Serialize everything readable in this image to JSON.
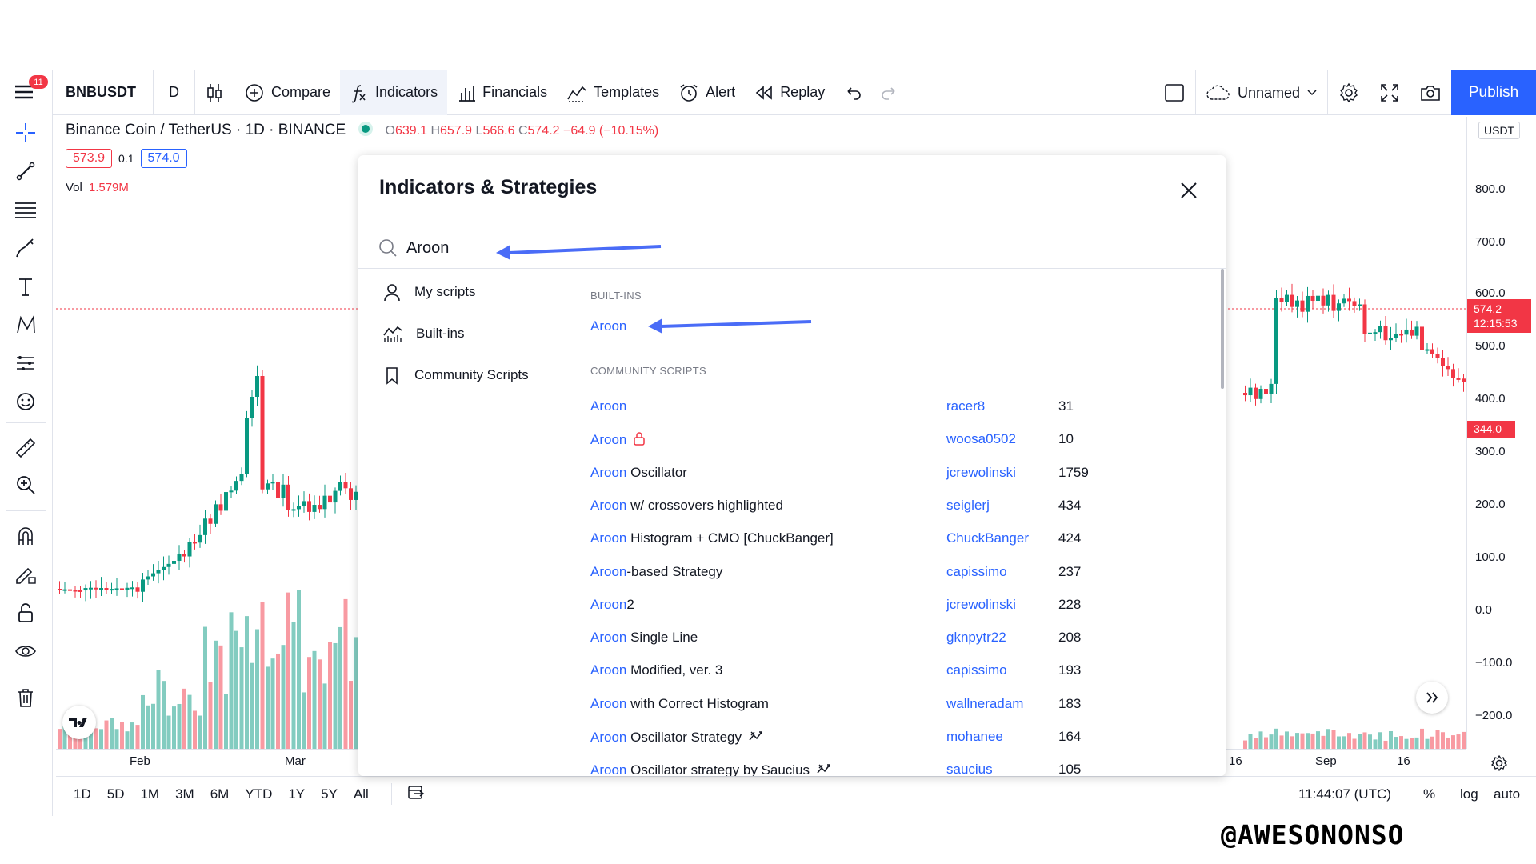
{
  "toolbar": {
    "menu_badge": "11",
    "symbol": "BNBUSDT",
    "interval": "D",
    "compare": "Compare",
    "indicators": "Indicators",
    "financials": "Financials",
    "templates": "Templates",
    "alert": "Alert",
    "replay": "Replay",
    "layout_name": "Unnamed",
    "publish": "Publish"
  },
  "legend": {
    "title": "Binance Coin / TetherUS · 1D · BINANCE",
    "o_label": "O",
    "o": "639.1",
    "h_label": "H",
    "h": "657.9",
    "l_label": "L",
    "l": "566.6",
    "c_label": "C",
    "c": "574.2",
    "change": "−64.9 (−10.15%)",
    "bid": "573.9",
    "spread": "0.1",
    "ask": "574.0",
    "vol_label": "Vol",
    "vol_value": "1.579M"
  },
  "price_scale": {
    "currency": "USDT",
    "labels": [
      "800.0",
      "700.0",
      "600.0",
      "500.0",
      "400.0",
      "300.0",
      "200.0",
      "100.0",
      "0.0",
      "−100.0",
      "−200.0"
    ],
    "last_price": "574.2",
    "countdown": "12:15:53",
    "marker_price": "344.0"
  },
  "time_axis": {
    "labels": [
      "Feb",
      "Mar",
      "16",
      "Sep",
      "16"
    ]
  },
  "bottom": {
    "ranges": [
      "1D",
      "5D",
      "1M",
      "3M",
      "6M",
      "YTD",
      "1Y",
      "5Y",
      "All"
    ],
    "clock": "11:44:07 (UTC)",
    "percent": "%",
    "log": "log",
    "auto": "auto"
  },
  "dialog": {
    "title": "Indicators & Strategies",
    "search_value": "Aroon",
    "sidebar": [
      "My scripts",
      "Built-ins",
      "Community Scripts"
    ],
    "builtins_header": "BUILT-INS",
    "builtin_item": "Aroon",
    "community_header": "COMMUNITY SCRIPTS",
    "community": [
      {
        "match": "Aroon",
        "rest": "",
        "author": "racer8",
        "count": "31",
        "badge": ""
      },
      {
        "match": "Aroon",
        "rest": "",
        "author": "woosa0502",
        "count": "10",
        "badge": "lock"
      },
      {
        "match": "Aroon",
        "rest": " Oscillator",
        "author": "jcrewolinski",
        "count": "1759",
        "badge": ""
      },
      {
        "match": "Aroon",
        "rest": " w/ crossovers highlighted",
        "author": "seiglerj",
        "count": "434",
        "badge": ""
      },
      {
        "match": "Aroon",
        "rest": " Histogram + CMO [ChuckBanger]",
        "author": "ChuckBanger",
        "count": "424",
        "badge": ""
      },
      {
        "match": "Aroon",
        "rest": "-based Strategy",
        "author": "capissimo",
        "count": "237",
        "badge": ""
      },
      {
        "match": "Aroon",
        "rest": "2",
        "author": "jcrewolinski",
        "count": "228",
        "badge": ""
      },
      {
        "match": "Aroon",
        "rest": " Single Line",
        "author": "gknpytr22",
        "count": "208",
        "badge": ""
      },
      {
        "match": "Aroon",
        "rest": " Modified, ver. 3",
        "author": "capissimo",
        "count": "193",
        "badge": ""
      },
      {
        "match": "Aroon",
        "rest": " with Correct Histogram",
        "author": "wallneradam",
        "count": "183",
        "badge": ""
      },
      {
        "match": "Aroon",
        "rest": " Oscillator Strategy",
        "author": "mohanee",
        "count": "164",
        "badge": "strategy"
      },
      {
        "match": "Aroon",
        "rest": " Oscillator strategy by Saucius",
        "author": "saucius",
        "count": "105",
        "badge": "strategy"
      }
    ]
  },
  "watermark": "@AWESONONSO",
  "colors": {
    "accent": "#2962ff",
    "up": "#089981",
    "down": "#f23645",
    "annotation_arrow": "#4a6cf7"
  }
}
